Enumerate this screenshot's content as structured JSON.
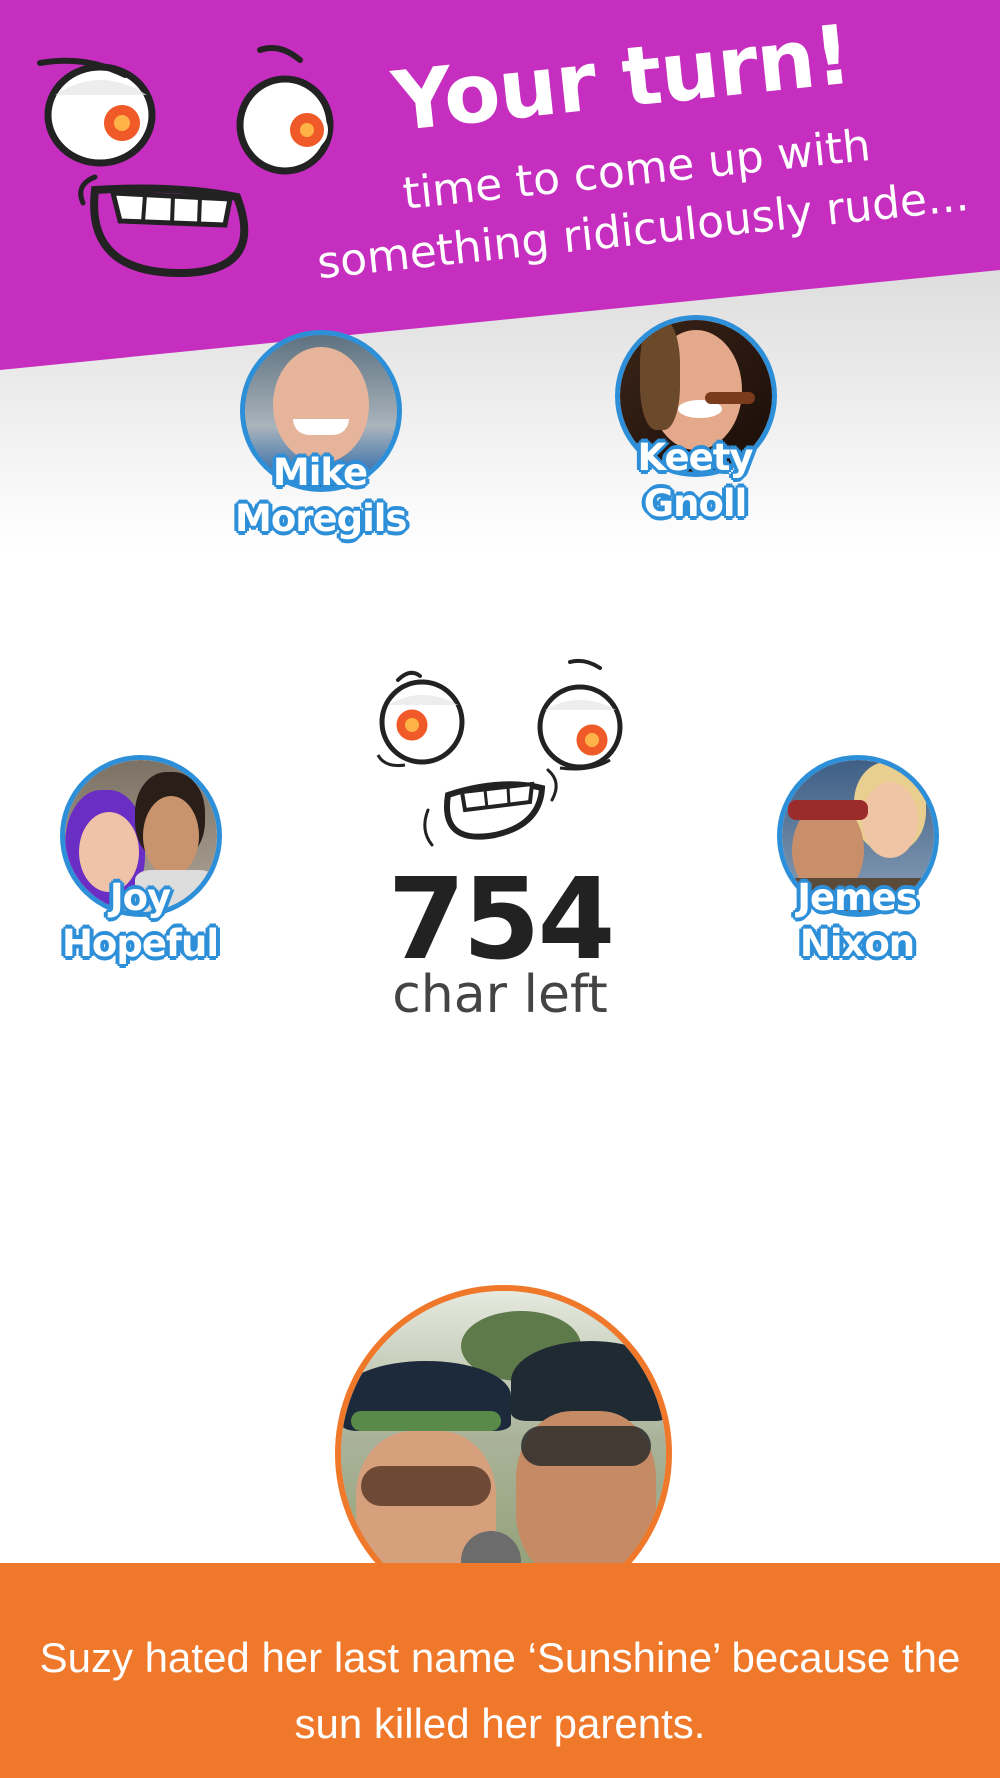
{
  "header": {
    "title": "Your turn!",
    "subtitle_line1": "time to come up with",
    "subtitle_line2": "something ridiculously rude...",
    "background_color": "#c62ec0",
    "mascot_icon": "cartoon-face-icon"
  },
  "players": [
    {
      "first": "Mike",
      "last": "Moregils"
    },
    {
      "first": "Keety",
      "last": "Gnoll"
    },
    {
      "first": "Joy",
      "last": "Hopeful"
    },
    {
      "first": "Jemes",
      "last": "Nixon"
    }
  ],
  "counter": {
    "value": "754",
    "label": "char left",
    "mascot_icon": "cartoon-face-icon"
  },
  "current_player": {
    "border_color": "#f0782a"
  },
  "prompt": {
    "text": "Suzy hated her last name ‘Sunshine’ because the sun killed her parents.",
    "background_color": "#f0782a"
  },
  "colors": {
    "avatar_border": "#2e8fd9",
    "accent_orange": "#f0782a",
    "accent_magenta": "#c62ec0"
  }
}
